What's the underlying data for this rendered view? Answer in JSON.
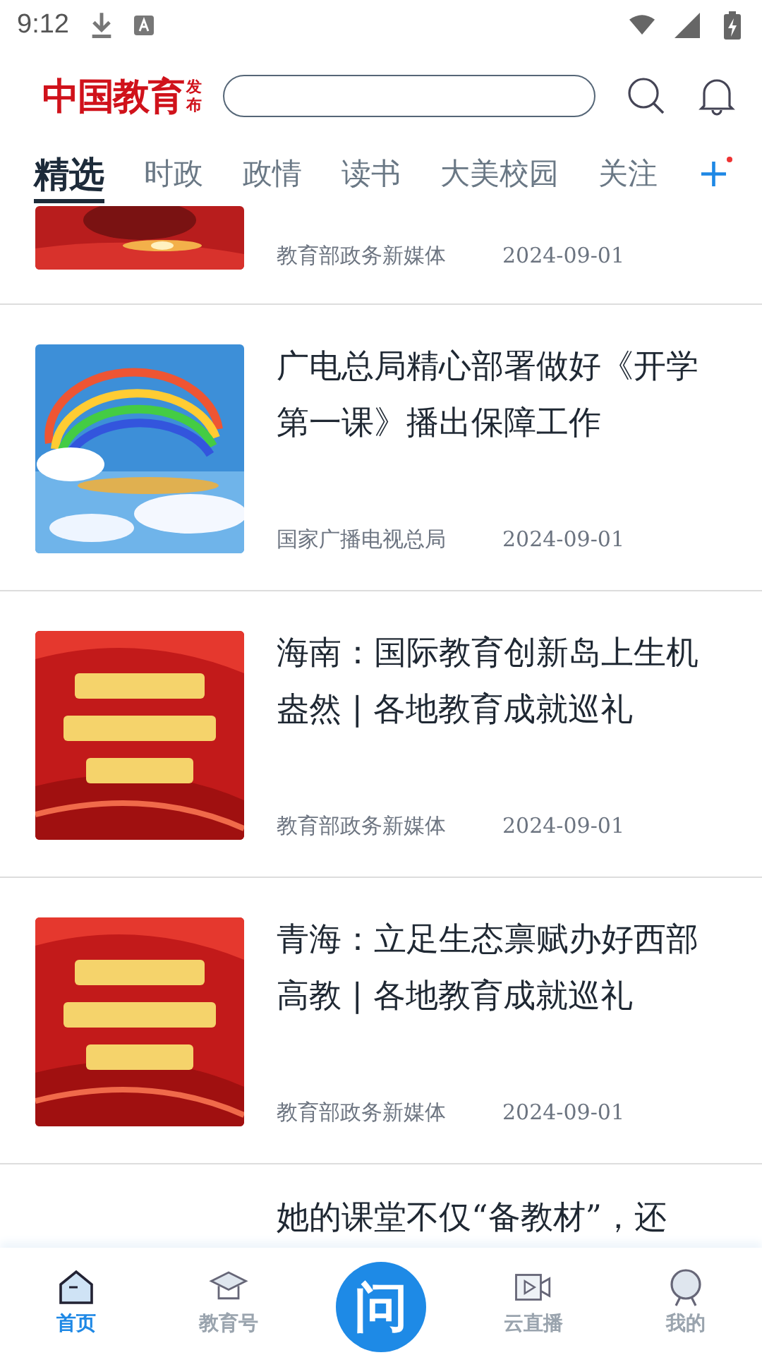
{
  "status_bar": {
    "time": "9:12"
  },
  "header": {
    "logo": "中国教育",
    "logo_side": "发布",
    "search": {
      "kind": "field"
    }
  },
  "tabs": [
    {
      "label": "精选",
      "selected": true
    },
    {
      "label": "时政",
      "selected": false
    },
    {
      "label": "政情",
      "selected": false
    },
    {
      "label": "读书",
      "selected": false
    },
    {
      "label": "大美校园",
      "selected": false
    },
    {
      "label": "关注",
      "selected": false
    }
  ],
  "tab_add": "+",
  "articles": [
    {
      "kind": "cut_top",
      "source": "教育部政务新媒体",
      "date": "2024-09-01"
    },
    {
      "kind": "full",
      "title": "广电总局精心部署做好《开学第一课》播出保障工作",
      "source": "国家广播电视总局",
      "date": "2024-09-01"
    },
    {
      "kind": "full",
      "title": "海南：国际教育创新岛上生机盎然 | 各地教育成就巡礼",
      "source": "教育部政务新媒体",
      "date": "2024-09-01"
    },
    {
      "kind": "full",
      "title": "青海：立足生态禀赋办好西部高教 | 各地教育成就巡礼",
      "source": "教育部政务新媒体",
      "date": "2024-09-01"
    },
    {
      "kind": "cut_bottom",
      "title": "她的课堂不仅“备教材”，还"
    }
  ],
  "bottom_nav": [
    {
      "kind": "home",
      "label": "首页",
      "selected": true
    },
    {
      "kind": "cap",
      "label": "教育号",
      "selected": false
    },
    {
      "kind": "center",
      "label": "问",
      "selected": false
    },
    {
      "kind": "video",
      "label": "云直播",
      "selected": false
    },
    {
      "kind": "user",
      "label": "我的",
      "selected": false
    }
  ]
}
